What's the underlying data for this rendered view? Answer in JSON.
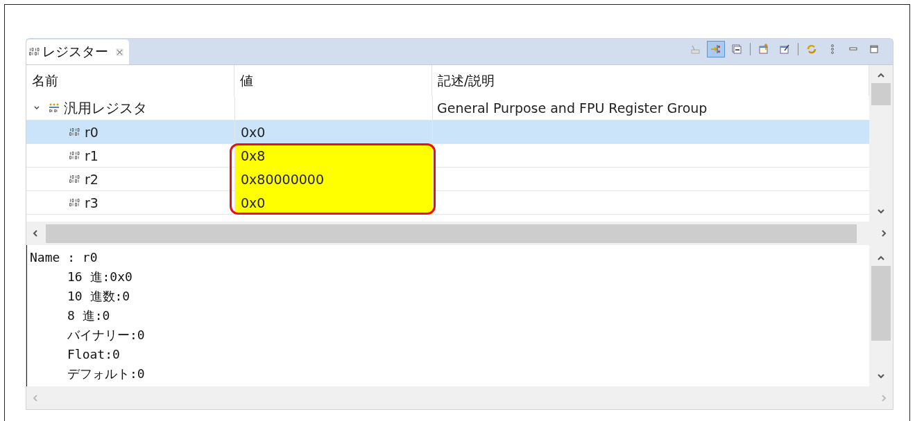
{
  "tab": {
    "title": "レジスター",
    "selected": true
  },
  "toolbar": [
    {
      "kind": "disabled-tool",
      "selected": false
    },
    {
      "kind": "link",
      "selected": true
    },
    {
      "kind": "collapse",
      "selected": false
    },
    {
      "kind": "separator"
    },
    {
      "kind": "export",
      "selected": false
    },
    {
      "kind": "pin",
      "selected": false
    },
    {
      "kind": "separator"
    },
    {
      "kind": "refresh",
      "selected": false
    },
    {
      "kind": "menu",
      "selected": false
    },
    {
      "kind": "minimize",
      "selected": false
    },
    {
      "kind": "maximize",
      "selected": false
    }
  ],
  "table": {
    "columns": [
      "名前",
      "値",
      "記述/説明"
    ],
    "group": {
      "name": "汎用レジスタ",
      "expanded": true,
      "description": "General Purpose and FPU Register Group"
    },
    "rows": [
      {
        "name": "r0",
        "value": "0x0",
        "selected": true,
        "highlighted": false
      },
      {
        "name": "r1",
        "value": "0x8",
        "selected": false,
        "highlighted": true
      },
      {
        "name": "r2",
        "value": "0x80000000",
        "selected": false,
        "highlighted": true
      },
      {
        "name": "r3",
        "value": "0x0",
        "selected": false,
        "highlighted": true
      }
    ]
  },
  "detail": {
    "title": "Name : r0",
    "fields": [
      "16 進:0x0",
      "10 進数:0",
      "8 進:0",
      "バイナリー:0",
      "Float:0",
      "デフォルト:0"
    ]
  }
}
